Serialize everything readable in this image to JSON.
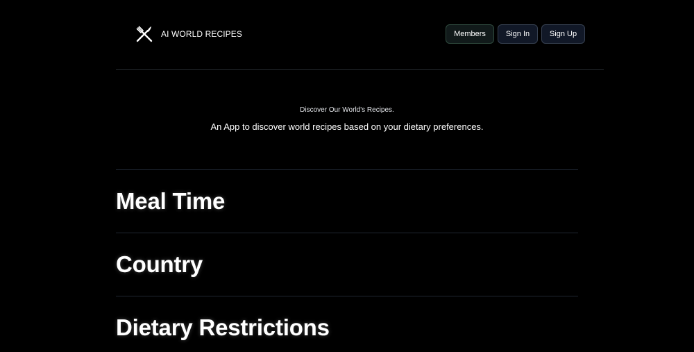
{
  "brand": {
    "name": "AI WORLD RECIPES",
    "icon": "fork-knife-icon"
  },
  "nav": {
    "members_label": "Members",
    "signin_label": "Sign In",
    "signup_label": "Sign Up"
  },
  "hero": {
    "eyebrow": "Discover Our World's Recipes.",
    "tagline": "An App to discover world recipes based on your dietary preferences."
  },
  "sections": [
    {
      "title": "Meal Time"
    },
    {
      "title": "Country"
    },
    {
      "title": "Dietary Restrictions"
    }
  ],
  "colors": {
    "background": "#000000",
    "text": "#ffffff",
    "divider": "#1f2733",
    "button_bg": "#111827",
    "button_border": "#374151"
  }
}
